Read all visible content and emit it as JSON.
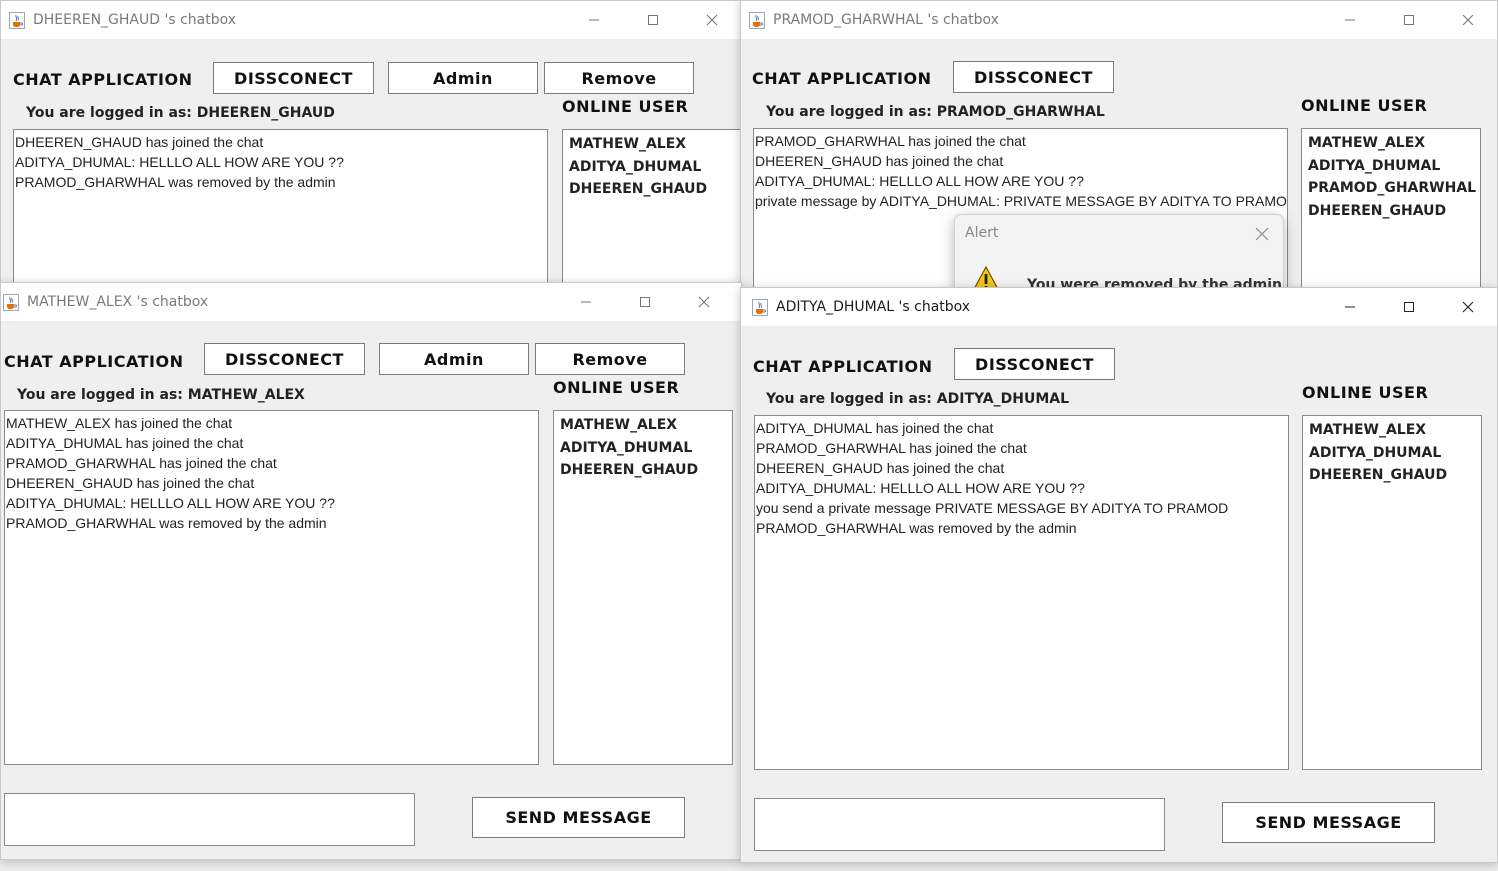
{
  "windows": {
    "dheeren": {
      "title": "DHEEREN_GHAUD 's chatbox",
      "app_title": "CHAT APPLICATION",
      "disconnect_label": "DISSCONECT",
      "admin_label": "Admin",
      "remove_label": "Remove",
      "online_label": "ONLINE USER",
      "logged_in": "You are logged in as: DHEEREN_GHAUD",
      "messages": [
        "DHEEREN_GHAUD has joined the chat",
        "ADITYA_DHUMAL: HELLLO ALL HOW ARE YOU ??",
        "PRAMOD_GHARWHAL was removed by the admin"
      ],
      "online_users": [
        "MATHEW_ALEX",
        "ADITYA_DHUMAL",
        "DHEEREN_GHAUD"
      ]
    },
    "pramod": {
      "title": "PRAMOD_GHARWHAL 's chatbox",
      "app_title": "CHAT APPLICATION",
      "disconnect_label": "DISSCONECT",
      "online_label": "ONLINE USER",
      "logged_in": "You are logged in as: PRAMOD_GHARWHAL",
      "messages": [
        "PRAMOD_GHARWHAL has joined the chat",
        "DHEEREN_GHAUD has joined the chat",
        "ADITYA_DHUMAL: HELLLO ALL HOW ARE YOU ??",
        "private message by ADITYA_DHUMAL: PRIVATE MESSAGE BY ADITYA TO PRAMOD"
      ],
      "online_users": [
        "MATHEW_ALEX",
        "ADITYA_DHUMAL",
        "PRAMOD_GHARWHAL",
        "DHEEREN_GHAUD"
      ]
    },
    "mathew": {
      "title": "MATHEW_ALEX 's chatbox",
      "app_title": "CHAT APPLICATION",
      "disconnect_label": "DISSCONECT",
      "admin_label": "Admin",
      "remove_label": "Remove",
      "online_label": "ONLINE USER",
      "logged_in": "You are logged in as: MATHEW_ALEX",
      "messages": [
        "MATHEW_ALEX has joined the chat",
        "ADITYA_DHUMAL has joined the chat",
        "PRAMOD_GHARWHAL has joined the chat",
        "DHEEREN_GHAUD has joined the chat",
        "ADITYA_DHUMAL: HELLLO ALL HOW ARE YOU ??",
        "PRAMOD_GHARWHAL was removed by the admin"
      ],
      "online_users": [
        "MATHEW_ALEX",
        "ADITYA_DHUMAL",
        "DHEEREN_GHAUD"
      ],
      "send_label": "SEND MESSAGE",
      "input_value": ""
    },
    "aditya": {
      "title": "ADITYA_DHUMAL 's chatbox",
      "app_title": "CHAT APPLICATION",
      "disconnect_label": "DISSCONECT",
      "online_label": "ONLINE USER",
      "logged_in": "You are logged in as: ADITYA_DHUMAL",
      "messages": [
        "ADITYA_DHUMAL has joined the chat",
        "PRAMOD_GHARWHAL has joined the chat",
        "DHEEREN_GHAUD has joined the chat",
        "ADITYA_DHUMAL: HELLLO ALL HOW ARE YOU ??",
        "you send a private message  PRIVATE MESSAGE BY ADITYA TO PRAMOD",
        "PRAMOD_GHARWHAL was removed by the admin"
      ],
      "online_users": [
        "MATHEW_ALEX",
        "ADITYA_DHUMAL",
        "DHEEREN_GHAUD"
      ],
      "send_label": "SEND MESSAGE",
      "input_value": ""
    }
  },
  "alert": {
    "title": "Alert",
    "message": "You were removed by the admin",
    "icon": "warning-icon"
  },
  "icons": {
    "app": "java-cup-icon",
    "minimize": "minimize-icon",
    "maximize": "maximize-icon",
    "close": "close-icon"
  }
}
